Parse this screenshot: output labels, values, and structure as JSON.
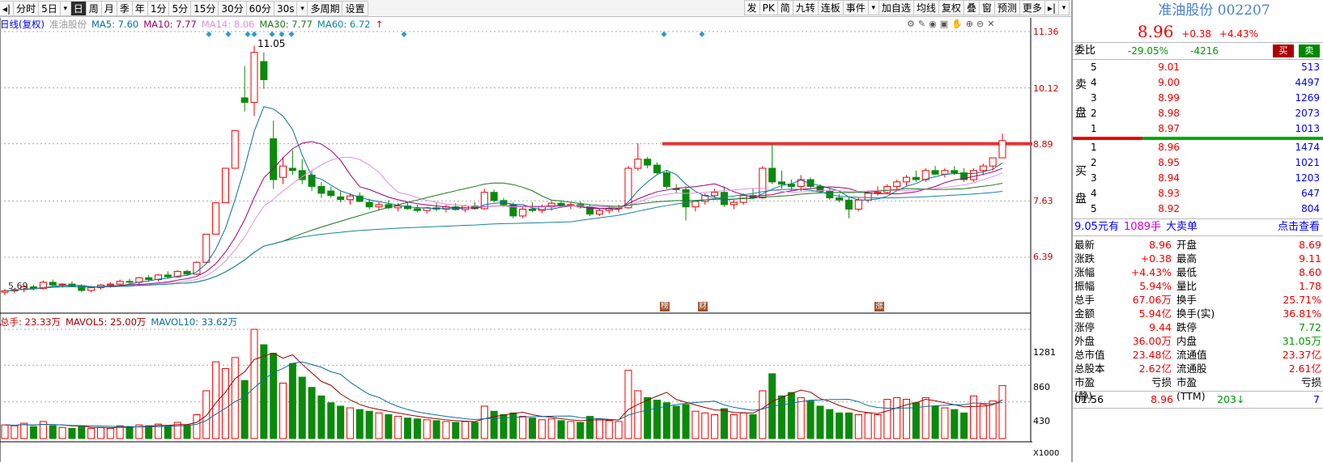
{
  "toolbar": {
    "left_items": [
      "分时",
      "5日",
      "▾",
      "日",
      "周",
      "月",
      "季",
      "年",
      "1分",
      "5分",
      "15分",
      "30分",
      "60分",
      "30s",
      "▾",
      "多周期",
      "设置"
    ],
    "active_index": 3,
    "right_items": [
      "发",
      "PK",
      "简",
      "九转",
      "连板",
      "事件",
      "▾",
      "加自选",
      "均线",
      "复权",
      "叠",
      "窗",
      "预测",
      "更多",
      "▸|",
      "▾"
    ]
  },
  "legend": {
    "label": "日线(复权)",
    "name": "准油股份",
    "ma5": "MA5: 7.60",
    "ma10": "MA10: 7.77",
    "ma14": "MA14: 8.06",
    "ma30": "MA30: 7.77",
    "ma60": "MA60: 6.72",
    "ma60_arrow": "↑"
  },
  "price_axis": [
    "11.36",
    "10.12",
    "8.89",
    "7.63",
    "6.39"
  ],
  "annotations": {
    "high": "11.05",
    "low": "5.69"
  },
  "event_marks": [
    "榜",
    "财",
    "涨"
  ],
  "volume_legend": {
    "total": "总手: 23.33万",
    "mavol5": "MAVOL5: 25.00万",
    "mavol10": "MAVOL10: 33.62万"
  },
  "volume_axis": [
    "1281",
    "860",
    "430",
    "X1000"
  ],
  "chart_data": {
    "type": "candlestick",
    "price_axis": [
      6.39,
      7.63,
      8.89,
      10.12,
      11.36
    ],
    "volume_axis": [
      430,
      860,
      1281
    ],
    "resistance_line": 8.89,
    "candles": [
      [
        5.62,
        5.69,
        5.55,
        5.65,
        160
      ],
      [
        5.65,
        5.7,
        5.6,
        5.68,
        150
      ],
      [
        5.68,
        5.78,
        5.62,
        5.74,
        180
      ],
      [
        5.74,
        5.78,
        5.66,
        5.7,
        140
      ],
      [
        5.7,
        5.88,
        5.68,
        5.84,
        200
      ],
      [
        5.84,
        5.9,
        5.74,
        5.78,
        150
      ],
      [
        5.78,
        5.82,
        5.72,
        5.8,
        130
      ],
      [
        5.8,
        5.86,
        5.74,
        5.76,
        120
      ],
      [
        5.76,
        5.8,
        5.62,
        5.66,
        140
      ],
      [
        5.66,
        5.76,
        5.62,
        5.72,
        120
      ],
      [
        5.72,
        5.8,
        5.68,
        5.78,
        130
      ],
      [
        5.78,
        5.84,
        5.72,
        5.8,
        120
      ],
      [
        5.8,
        5.9,
        5.76,
        5.86,
        150
      ],
      [
        5.86,
        5.92,
        5.8,
        5.84,
        140
      ],
      [
        5.84,
        5.96,
        5.8,
        5.94,
        160
      ],
      [
        5.94,
        6.0,
        5.86,
        5.9,
        150
      ],
      [
        5.9,
        6.02,
        5.86,
        6.0,
        170
      ],
      [
        6.0,
        6.08,
        5.92,
        5.96,
        150
      ],
      [
        5.96,
        6.1,
        5.94,
        6.08,
        190
      ],
      [
        6.08,
        6.12,
        6.0,
        6.02,
        160
      ],
      [
        6.02,
        6.3,
        6.0,
        6.28,
        280
      ],
      [
        6.28,
        6.9,
        6.25,
        6.9,
        560
      ],
      [
        6.9,
        7.59,
        6.9,
        7.59,
        900
      ],
      [
        7.59,
        8.35,
        7.59,
        8.35,
        820
      ],
      [
        8.35,
        9.18,
        8.35,
        9.18,
        950
      ],
      [
        9.9,
        10.6,
        9.6,
        9.8,
        680
      ],
      [
        9.8,
        11.05,
        9.5,
        10.9,
        1281
      ],
      [
        10.7,
        10.9,
        10.1,
        10.3,
        1100
      ],
      [
        9.0,
        9.4,
        7.9,
        8.1,
        1000
      ],
      [
        8.15,
        8.6,
        8.0,
        8.4,
        650
      ],
      [
        8.35,
        8.75,
        8.2,
        8.3,
        880
      ],
      [
        8.3,
        8.55,
        8.0,
        8.1,
        720
      ],
      [
        8.2,
        8.3,
        7.85,
        7.95,
        600
      ],
      [
        7.95,
        8.05,
        7.7,
        7.8,
        500
      ],
      [
        7.85,
        7.95,
        7.7,
        7.75,
        420
      ],
      [
        7.72,
        7.84,
        7.6,
        7.66,
        380
      ],
      [
        7.66,
        7.8,
        7.55,
        7.74,
        360
      ],
      [
        7.74,
        7.82,
        7.6,
        7.62,
        340
      ],
      [
        7.6,
        7.68,
        7.45,
        7.5,
        320
      ],
      [
        7.5,
        7.6,
        7.42,
        7.55,
        300
      ],
      [
        7.55,
        7.65,
        7.45,
        7.48,
        280
      ],
      [
        7.48,
        7.58,
        7.4,
        7.52,
        260
      ],
      [
        7.52,
        7.6,
        7.44,
        7.46,
        240
      ],
      [
        7.46,
        7.55,
        7.38,
        7.42,
        230
      ],
      [
        7.42,
        7.5,
        7.35,
        7.48,
        220
      ],
      [
        7.48,
        7.6,
        7.4,
        7.45,
        210
      ],
      [
        7.45,
        7.55,
        7.38,
        7.5,
        200
      ],
      [
        7.5,
        7.58,
        7.42,
        7.44,
        190
      ],
      [
        7.44,
        7.55,
        7.38,
        7.52,
        200
      ],
      [
        7.52,
        7.6,
        7.44,
        7.46,
        190
      ],
      [
        7.46,
        7.9,
        7.44,
        7.82,
        380
      ],
      [
        7.82,
        7.88,
        7.6,
        7.64,
        320
      ],
      [
        7.64,
        7.7,
        7.5,
        7.55,
        280
      ],
      [
        7.55,
        7.6,
        7.25,
        7.3,
        300
      ],
      [
        7.3,
        7.5,
        7.25,
        7.45,
        260
      ],
      [
        7.45,
        7.6,
        7.38,
        7.42,
        240
      ],
      [
        7.42,
        7.55,
        7.36,
        7.5,
        220
      ],
      [
        7.5,
        7.62,
        7.42,
        7.58,
        230
      ],
      [
        7.58,
        7.64,
        7.48,
        7.52,
        210
      ],
      [
        7.52,
        7.6,
        7.45,
        7.55,
        200
      ],
      [
        7.55,
        7.62,
        7.46,
        7.5,
        190
      ],
      [
        7.5,
        7.56,
        7.3,
        7.34,
        260
      ],
      [
        7.34,
        7.45,
        7.3,
        7.42,
        230
      ],
      [
        7.42,
        7.5,
        7.35,
        7.46,
        210
      ],
      [
        7.46,
        7.55,
        7.38,
        7.48,
        200
      ],
      [
        7.48,
        8.4,
        7.46,
        8.35,
        800
      ],
      [
        8.35,
        8.9,
        8.3,
        8.55,
        560
      ],
      [
        8.55,
        8.6,
        8.35,
        8.42,
        480
      ],
      [
        8.42,
        8.48,
        8.2,
        8.25,
        450
      ],
      [
        8.25,
        8.3,
        7.9,
        7.95,
        420
      ],
      [
        7.9,
        8.0,
        7.8,
        7.88,
        380
      ],
      [
        7.88,
        7.95,
        7.2,
        7.5,
        400
      ],
      [
        7.5,
        7.65,
        7.4,
        7.62,
        320
      ],
      [
        7.62,
        7.8,
        7.55,
        7.75,
        300
      ],
      [
        7.75,
        7.9,
        7.7,
        7.82,
        280
      ],
      [
        7.82,
        7.95,
        7.5,
        7.55,
        350
      ],
      [
        7.55,
        7.65,
        7.45,
        7.6,
        280
      ],
      [
        7.6,
        7.8,
        7.55,
        7.75,
        300
      ],
      [
        7.75,
        7.9,
        7.7,
        7.7,
        280
      ],
      [
        7.7,
        8.4,
        7.68,
        8.35,
        560
      ],
      [
        8.35,
        8.89,
        8.0,
        8.05,
        760
      ],
      [
        8.05,
        8.3,
        7.9,
        8.0,
        500
      ],
      [
        8.0,
        8.1,
        7.85,
        7.95,
        540
      ],
      [
        7.95,
        8.2,
        7.85,
        8.1,
        480
      ],
      [
        8.1,
        8.15,
        7.9,
        7.95,
        440
      ],
      [
        7.95,
        8.0,
        7.8,
        7.84,
        380
      ],
      [
        7.84,
        7.9,
        7.65,
        7.7,
        340
      ],
      [
        7.7,
        7.78,
        7.6,
        7.65,
        300
      ],
      [
        7.65,
        7.72,
        7.25,
        7.45,
        300
      ],
      [
        7.45,
        7.7,
        7.4,
        7.65,
        280
      ],
      [
        7.65,
        7.85,
        7.6,
        7.8,
        300
      ],
      [
        7.8,
        7.95,
        7.75,
        7.82,
        280
      ],
      [
        7.82,
        8.0,
        7.8,
        7.95,
        460
      ],
      [
        7.95,
        8.1,
        7.85,
        8.05,
        480
      ],
      [
        8.05,
        8.2,
        7.95,
        8.15,
        460
      ],
      [
        8.15,
        8.3,
        8.05,
        8.1,
        420
      ],
      [
        8.1,
        8.35,
        8.05,
        8.3,
        480
      ],
      [
        8.3,
        8.4,
        8.2,
        8.22,
        380
      ],
      [
        8.22,
        8.35,
        8.15,
        8.3,
        360
      ],
      [
        8.3,
        8.4,
        8.2,
        8.25,
        340
      ],
      [
        8.25,
        8.35,
        8.05,
        8.1,
        300
      ],
      [
        8.1,
        8.35,
        8.05,
        8.3,
        500
      ],
      [
        8.3,
        8.45,
        8.2,
        8.4,
        400
      ],
      [
        8.4,
        8.55,
        8.3,
        8.58,
        440
      ],
      [
        8.58,
        9.11,
        8.6,
        8.96,
        620
      ]
    ]
  },
  "panel": {
    "title": "准油股份 002207",
    "price": "8.96",
    "change": "+0.38",
    "pct": "+4.43%",
    "weibi_label": "委比",
    "weibi": "-29.05%",
    "weicha": "-4216",
    "sell_btn": "买",
    "buy_btn": "卖",
    "sell_chars": [
      "卖",
      "盘"
    ],
    "buy_chars": [
      "买",
      "盘"
    ],
    "asks": [
      {
        "lvl": "5",
        "price": "9.01",
        "qty": "513"
      },
      {
        "lvl": "4",
        "price": "9.00",
        "qty": "4497"
      },
      {
        "lvl": "3",
        "price": "8.99",
        "qty": "1269"
      },
      {
        "lvl": "2",
        "price": "8.98",
        "qty": "2073"
      },
      {
        "lvl": "1",
        "price": "8.97",
        "qty": "1013"
      }
    ],
    "bids": [
      {
        "lvl": "1",
        "price": "8.96",
        "qty": "1474"
      },
      {
        "lvl": "2",
        "price": "8.95",
        "qty": "1021"
      },
      {
        "lvl": "3",
        "price": "8.94",
        "qty": "1203"
      },
      {
        "lvl": "4",
        "price": "8.93",
        "qty": "647"
      },
      {
        "lvl": "5",
        "price": "8.92",
        "qty": "804"
      }
    ],
    "big_order": {
      "price": "9.05元有",
      "qty": "1089手",
      "label": "大卖单",
      "link": "点击查看"
    },
    "quotes": [
      {
        "k": "最新",
        "v": "8.96",
        "vc": "red",
        "k2": "开盘",
        "v2": "8.69",
        "v2c": "red"
      },
      {
        "k": "涨跌",
        "v": "+0.38",
        "vc": "red",
        "k2": "最高",
        "v2": "9.11",
        "v2c": "red"
      },
      {
        "k": "涨幅",
        "v": "+4.43%",
        "vc": "red",
        "k2": "最低",
        "v2": "8.60",
        "v2c": "red"
      },
      {
        "k": "振幅",
        "v": "5.94%",
        "vc": "red",
        "k2": "量比",
        "v2": "1.78",
        "v2c": "red"
      },
      {
        "k": "总手",
        "v": "67.06万",
        "vc": "red",
        "k2": "换手",
        "v2": "25.71%",
        "v2c": "red"
      },
      {
        "k": "金额",
        "v": "5.94亿",
        "vc": "red",
        "k2": "换手(实)",
        "v2": "36.81%",
        "v2c": "red"
      },
      {
        "k": "涨停",
        "v": "9.44",
        "vc": "red",
        "k2": "跌停",
        "v2": "7.72",
        "v2c": "green"
      },
      {
        "k": "外盘",
        "v": "36.00万",
        "vc": "red",
        "k2": "内盘",
        "v2": "31.05万",
        "v2c": "green"
      },
      {
        "k": "总市值",
        "v": "23.48亿",
        "vc": "red",
        "k2": "流通值",
        "v2": "23.37亿",
        "v2c": "red"
      },
      {
        "k": "总股本",
        "v": "2.62亿",
        "vc": "red",
        "k2": "流通股",
        "v2": "2.61亿",
        "v2c": "red"
      },
      {
        "k": "市盈(静)",
        "v": "亏损",
        "vc": "",
        "k2": "市盈(TTM)",
        "v2": "亏损",
        "v2c": ""
      }
    ],
    "tick": {
      "time": "01:56",
      "price": "8.96",
      "vol": "203",
      "arrow": "↓",
      "num": "7"
    }
  }
}
